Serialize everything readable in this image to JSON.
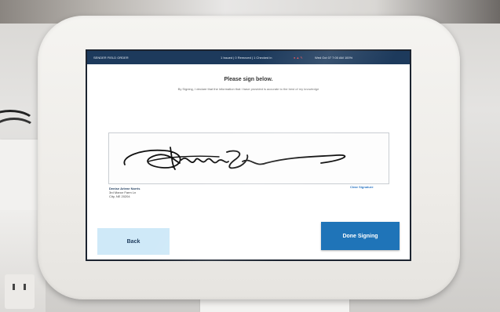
{
  "status_bar": {
    "left_text": "SENDER FIELD ORDER",
    "mid_text": "1 Issued | 0 Removed | 1 Checked in",
    "right_text": "Wed Oct 07  7:00 AM  100%"
  },
  "prompt": {
    "title": "Please sign below.",
    "subtitle": "By Signing, I declare that the information that I have provided is accurate to the best of my knowledge"
  },
  "signer": {
    "name": "Denise Arlene Norris",
    "address_line1": "3rd Manor Farm Ln",
    "address_line2": "City, NE 20204"
  },
  "actions": {
    "clear_signature": "Clear Signature",
    "back": "Back",
    "done": "Done Signing"
  },
  "colors": {
    "header_bg": "#1d3a5c",
    "done_button": "#1f74b8",
    "back_button": "#cfe9f8",
    "link": "#2f78c4"
  },
  "icons": [
    "user-icon",
    "alert-icon",
    "settings-icon"
  ]
}
